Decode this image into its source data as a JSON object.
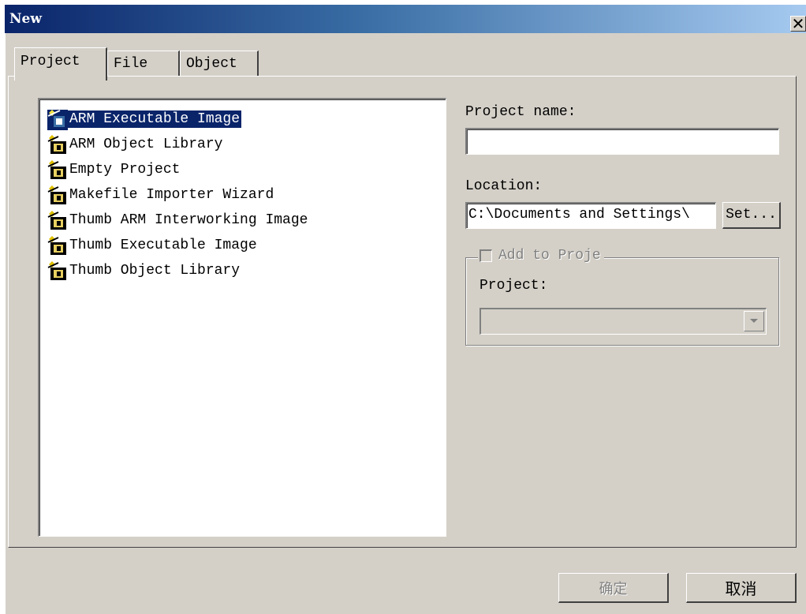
{
  "window": {
    "title": "New",
    "close_glyph": "✕"
  },
  "tabs": [
    {
      "label": "Project",
      "active": true
    },
    {
      "label": "File",
      "active": false
    },
    {
      "label": "Object",
      "active": false
    }
  ],
  "project_types": {
    "selected_index": 0,
    "items": [
      {
        "label": "ARM Executable Image",
        "icon": "project-wizard-icon"
      },
      {
        "label": "ARM Object Library",
        "icon": "project-wizard-icon"
      },
      {
        "label": "Empty Project",
        "icon": "project-wizard-icon"
      },
      {
        "label": "Makefile Importer Wizard",
        "icon": "project-wizard-icon"
      },
      {
        "label": "Thumb ARM Interworking Image",
        "icon": "project-wizard-icon"
      },
      {
        "label": "Thumb Executable Image",
        "icon": "project-wizard-icon"
      },
      {
        "label": "Thumb Object Library",
        "icon": "project-wizard-icon"
      }
    ]
  },
  "form": {
    "project_name_label": "Project name:",
    "project_name_value": "",
    "location_label": "Location:",
    "location_value": "C:\\Documents and Settings\\",
    "set_button": "Set...",
    "add_to_project_label": "Add to Proje",
    "add_to_project_checked": false,
    "project_label": "Project:",
    "project_value": ""
  },
  "footer": {
    "ok_button": "确定",
    "ok_disabled": true,
    "cancel_button": "取消"
  },
  "colors": {
    "title_start": "#0a246a",
    "title_end": "#a6caf0",
    "face": "#d4d0c8",
    "selection": "#0a246a"
  }
}
